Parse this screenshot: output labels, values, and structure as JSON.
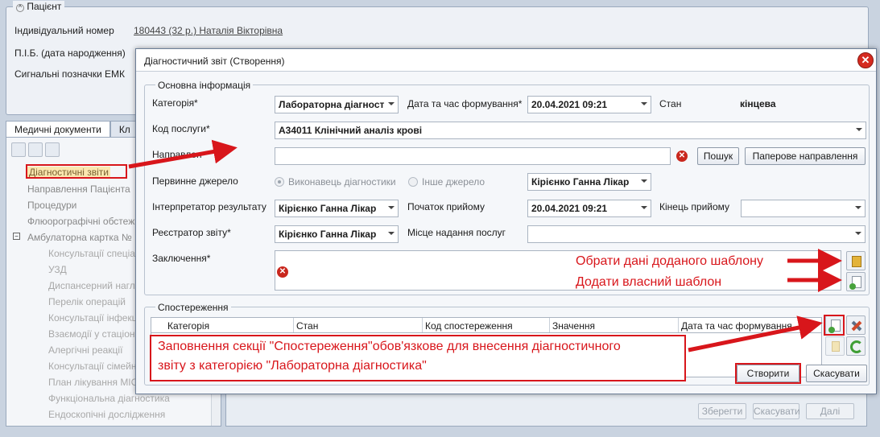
{
  "patient": {
    "legend": "Пацієнт",
    "id_label": "Індивідуальний номер",
    "id_value": "180443 (32 р.) Наталія Вікторівна",
    "name_label": "П.І.Б. (дата народження)",
    "signals_label": "Сигнальні позначки ЕМК"
  },
  "tabs": [
    "Медичні документи",
    "Кл"
  ],
  "tree": {
    "items": [
      "Діагностичні звіти",
      "Направлення Пацієнта",
      "Процедури",
      "Флюорографічні обстеж",
      "Амбулаторна картка №"
    ],
    "subitems": [
      "Консультації спеціа",
      "УЗД",
      "Диспансерний нагля",
      "Перелік операцій",
      "Консультації інфекці",
      "Взаємодії у стаціона",
      "Алергічні реакції",
      "Консультації сімейно",
      "План лікування МІС",
      "Функціональна діагностика",
      "Ендоскопічні дослідження"
    ]
  },
  "bottom_buttons": {
    "save": "Зберегти",
    "cancel": "Скасувати",
    "next": "Далі"
  },
  "dialog": {
    "title": "Діагностичний звіт (Створення)",
    "main_legend": "Основна інформація",
    "category_label": "Категорія*",
    "category_value": "Лабораторна діагност",
    "datetime_label": "Дата та час формування*",
    "datetime_value": "20.04.2021 09:21",
    "state_label": "Стан",
    "state_value": "кінцева",
    "service_label": "Код послуги*",
    "service_value": "А34011 Клінічний аналіз крові",
    "referral_label": "Направлен",
    "search_button": "Пошук",
    "paper_button": "Паперове направлення",
    "source_label": "Первинне джерело",
    "radio_performer": "Виконавець діагностики",
    "radio_other": "Інше джерело",
    "source_value": "Кірієнко Ганна Лікар",
    "interpreter_label": "Інтерпретатор результату",
    "interpreter_value": "Кірієнко Ганна Лікар",
    "start_label": "Початок прийому",
    "start_value": "20.04.2021 09:21",
    "end_label": "Кінець прийому",
    "registrar_label": "Реєстратор звіту*",
    "registrar_value": "Кірієнко Ганна Лікар",
    "place_label": "Місце надання послуг",
    "conclusion_label": "Заключення*",
    "obs_legend": "Спостереження",
    "obs_columns": [
      "Категорія",
      "Стан",
      "Код спостереження",
      "Значення",
      "Дата та час формування"
    ],
    "create_button": "Створити",
    "cancel_button": "Скасувати"
  },
  "annotations": {
    "template_select": "Обрати дані доданого шаблону",
    "template_add": "Додати власний шаблон",
    "obs_note_line1": "Заповнення секції \"Спостереження\"обов'язкове для внесення діагностичного",
    "obs_note_line2": "звіту з категорією \"Лабораторна діагностика\""
  },
  "colors": {
    "annotation": "#d8161b",
    "accent": "#c8d6ea"
  }
}
